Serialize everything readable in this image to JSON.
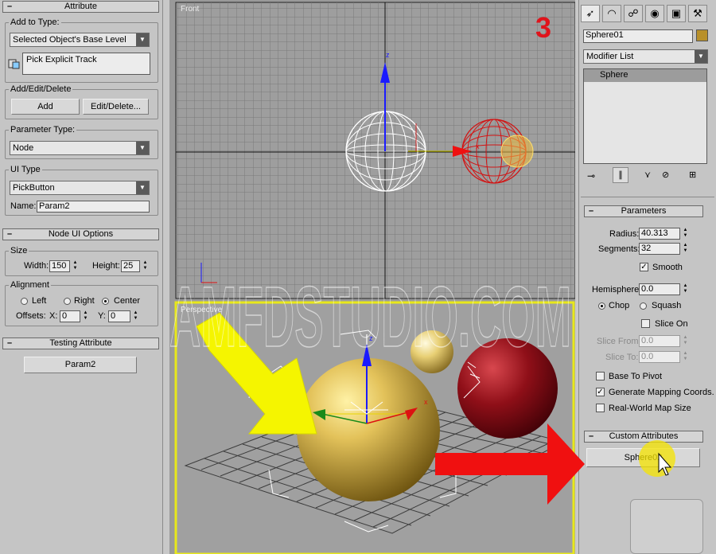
{
  "left_panel": {
    "attribute_rollout": {
      "title": "Attribute",
      "add_to_type": {
        "label": "Add to Type:",
        "value": "Selected Object's Base Level"
      },
      "pick_track": "Pick Explicit Track",
      "add_edit_delete": {
        "label": "Add/Edit/Delete",
        "add": "Add",
        "edit_delete": "Edit/Delete..."
      },
      "parameter_type": {
        "label": "Parameter Type:",
        "value": "Node"
      },
      "ui_type": {
        "label": "UI Type",
        "value": "PickButton",
        "name_label": "Name:",
        "name_value": "Param2"
      }
    },
    "node_ui_rollout": {
      "title": "Node UI Options",
      "size": {
        "label": "Size",
        "width_label": "Width:",
        "width_value": "150",
        "height_label": "Height:",
        "height_value": "25"
      },
      "alignment": {
        "label": "Alignment",
        "left": "Left",
        "right": "Right",
        "center": "Center",
        "offsets_label": "Offsets:",
        "x_label": "X:",
        "x_value": "0",
        "y_label": "Y:",
        "y_value": "0"
      }
    },
    "testing_rollout": {
      "title": "Testing Attribute",
      "button": "Param2"
    }
  },
  "viewports": {
    "front_label": "Front",
    "perspective_label": "Perspective",
    "step_number": "3",
    "watermark": "AMFDSTUDIO.COM",
    "axis_z": "z",
    "axis_x": "x"
  },
  "right_panel": {
    "object_name": "Sphere01",
    "object_color": "#b8902a",
    "modifier_list": "Modifier List",
    "stack_item": "Sphere",
    "parameters": {
      "title": "Parameters",
      "radius_label": "Radius:",
      "radius_value": "40.313",
      "segments_label": "Segments:",
      "segments_value": "32",
      "smooth": "Smooth",
      "hemisphere_label": "Hemisphere:",
      "hemisphere_value": "0.0",
      "chop": "Chop",
      "squash": "Squash",
      "slice_on": "Slice On",
      "slice_from_label": "Slice From:",
      "slice_from_value": "0.0",
      "slice_to_label": "Slice To:",
      "slice_to_value": "0.0",
      "base_to_pivot": "Base To Pivot",
      "generate_mapping": "Generate Mapping Coords.",
      "real_world": "Real-World Map Size"
    },
    "custom_attributes": {
      "title": "Custom Attributes",
      "button": "Sphere02"
    }
  },
  "minus_sign": "–",
  "check_mark": "✓"
}
